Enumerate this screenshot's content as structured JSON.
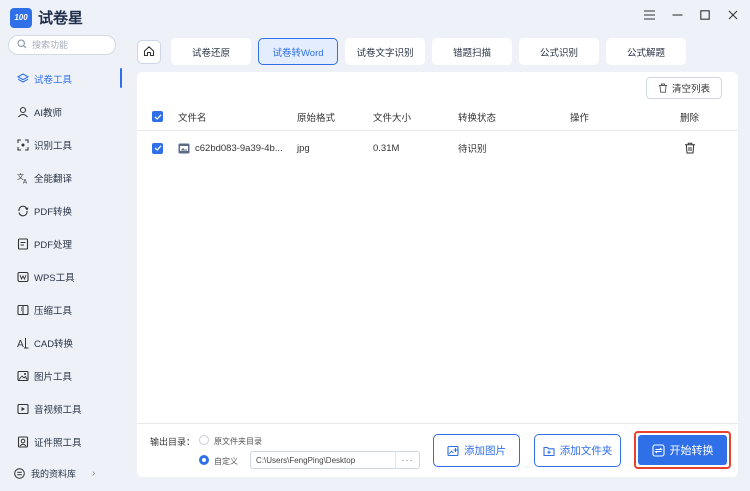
{
  "app": {
    "logo_badge": "100",
    "name": "试卷星"
  },
  "search": {
    "placeholder": "搜索功能"
  },
  "sidebar": {
    "items": [
      {
        "label": "试卷工具",
        "icon": "layers-icon",
        "active": true
      },
      {
        "label": "AI教师",
        "icon": "teacher-icon",
        "active": false
      },
      {
        "label": "识别工具",
        "icon": "scan-icon",
        "active": false
      },
      {
        "label": "全能翻译",
        "icon": "translate-icon",
        "active": false
      },
      {
        "label": "PDF转换",
        "icon": "convert-icon",
        "active": false
      },
      {
        "label": "PDF处理",
        "icon": "pdf-icon",
        "active": false
      },
      {
        "label": "WPS工具",
        "icon": "wps-icon",
        "active": false
      },
      {
        "label": "压缩工具",
        "icon": "compress-icon",
        "active": false
      },
      {
        "label": "CAD转换",
        "icon": "cad-icon",
        "active": false
      },
      {
        "label": "图片工具",
        "icon": "image-icon",
        "active": false
      },
      {
        "label": "音视频工具",
        "icon": "media-icon",
        "active": false
      },
      {
        "label": "证件照工具",
        "icon": "id-photo-icon",
        "active": false
      }
    ],
    "library_label": "我的资料库"
  },
  "tabs": [
    {
      "label": "试卷还原",
      "active": false
    },
    {
      "label": "试卷转Word",
      "active": true
    },
    {
      "label": "试卷文字识别",
      "active": false
    },
    {
      "label": "错题扫描",
      "active": false
    },
    {
      "label": "公式识别",
      "active": false
    },
    {
      "label": "公式解题",
      "active": false
    }
  ],
  "toolbar": {
    "clear_label": "清空列表"
  },
  "table": {
    "headers": {
      "name": "文件名",
      "format": "原始格式",
      "size": "文件大小",
      "status": "转换状态",
      "ops": "操作",
      "delete": "删除"
    },
    "rows": [
      {
        "name": "c62bd083-9a39-4b...",
        "format": "jpg",
        "size": "0.31M",
        "status": "待识别"
      }
    ]
  },
  "output": {
    "label": "输出目录：",
    "option_source": "原文件夹目录",
    "option_custom": "自定义",
    "path": "C:\\Users\\FengPing\\Desktop",
    "browse": "···"
  },
  "actions": {
    "add_image": "添加图片",
    "add_folder": "添加文件夹",
    "start": "开始转换"
  },
  "colors": {
    "accent": "#2f6fe8",
    "highlight": "#e8412c",
    "background": "#eef2f8"
  }
}
